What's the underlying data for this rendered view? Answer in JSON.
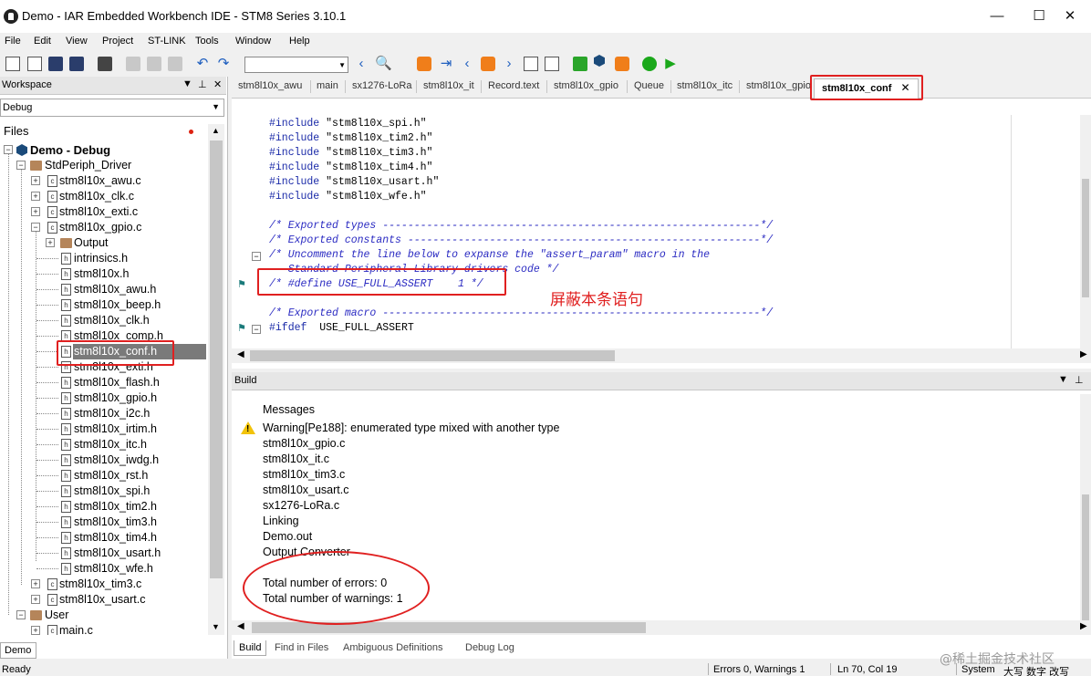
{
  "window": {
    "title": "Demo - IAR Embedded Workbench IDE - STM8 Series 3.10.1",
    "controls": {
      "minimize": "—",
      "maximize": "☐",
      "close": "✕"
    }
  },
  "menu": [
    "File",
    "Edit",
    "View",
    "Project",
    "ST-LINK",
    "Tools",
    "Window",
    "Help"
  ],
  "workspace": {
    "title": "Workspace",
    "configuration": "Debug",
    "files_header": "Files",
    "bottom_tab": "Demo",
    "tree": [
      {
        "label": "Demo - Debug",
        "kind": "project"
      },
      {
        "label": "StdPeriph_Driver",
        "kind": "folder"
      },
      {
        "label": "stm8l10x_awu.c",
        "kind": "c"
      },
      {
        "label": "stm8l10x_clk.c",
        "kind": "c"
      },
      {
        "label": "stm8l10x_exti.c",
        "kind": "c"
      },
      {
        "label": "stm8l10x_gpio.c",
        "kind": "c"
      },
      {
        "label": "Output",
        "kind": "folder"
      },
      {
        "label": "intrinsics.h",
        "kind": "h"
      },
      {
        "label": "stm8l10x.h",
        "kind": "h"
      },
      {
        "label": "stm8l10x_awu.h",
        "kind": "h"
      },
      {
        "label": "stm8l10x_beep.h",
        "kind": "h"
      },
      {
        "label": "stm8l10x_clk.h",
        "kind": "h"
      },
      {
        "label": "stm8l10x_comp.h",
        "kind": "h"
      },
      {
        "label": "stm8l10x_conf.h",
        "kind": "h",
        "selected": true
      },
      {
        "label": "stm8l10x_exti.h",
        "kind": "h"
      },
      {
        "label": "stm8l10x_flash.h",
        "kind": "h"
      },
      {
        "label": "stm8l10x_gpio.h",
        "kind": "h"
      },
      {
        "label": "stm8l10x_i2c.h",
        "kind": "h"
      },
      {
        "label": "stm8l10x_irtim.h",
        "kind": "h"
      },
      {
        "label": "stm8l10x_itc.h",
        "kind": "h"
      },
      {
        "label": "stm8l10x_iwdg.h",
        "kind": "h"
      },
      {
        "label": "stm8l10x_rst.h",
        "kind": "h"
      },
      {
        "label": "stm8l10x_spi.h",
        "kind": "h"
      },
      {
        "label": "stm8l10x_tim2.h",
        "kind": "h"
      },
      {
        "label": "stm8l10x_tim3.h",
        "kind": "h"
      },
      {
        "label": "stm8l10x_tim4.h",
        "kind": "h"
      },
      {
        "label": "stm8l10x_usart.h",
        "kind": "h"
      },
      {
        "label": "stm8l10x_wfe.h",
        "kind": "h"
      },
      {
        "label": "stm8l10x_tim3.c",
        "kind": "c"
      },
      {
        "label": "stm8l10x_usart.c",
        "kind": "c"
      },
      {
        "label": "User",
        "kind": "folder"
      },
      {
        "label": "main.c",
        "kind": "c"
      }
    ]
  },
  "editor": {
    "tabs": [
      "stm8l10x_awu",
      "main",
      "sx1276-LoRa",
      "stm8l10x_it",
      "Record.text",
      "stm8l10x_gpio",
      "Queue",
      "stm8l10x_itc",
      "stm8l10x_gpio",
      "stm8l10x_conf"
    ],
    "active_tab_close": "✕",
    "lines": [
      {
        "kind": "include",
        "kw": "#include",
        "rest": " \"stm8l10x_spi.h\""
      },
      {
        "kind": "include",
        "kw": "#include",
        "rest": " \"stm8l10x_tim2.h\""
      },
      {
        "kind": "include",
        "kw": "#include",
        "rest": " \"stm8l10x_tim3.h\""
      },
      {
        "kind": "include",
        "kw": "#include",
        "rest": " \"stm8l10x_tim4.h\""
      },
      {
        "kind": "include",
        "kw": "#include",
        "rest": " \"stm8l10x_usart.h\""
      },
      {
        "kind": "include",
        "kw": "#include",
        "rest": " \"stm8l10x_wfe.h\""
      },
      {
        "kind": "blank",
        "text": ""
      },
      {
        "kind": "comment",
        "text": "/* Exported types ------------------------------------------------------------*/"
      },
      {
        "kind": "comment",
        "text": "/* Exported constants --------------------------------------------------------*/"
      },
      {
        "kind": "comment",
        "text": "/* Uncomment the line below to expanse the \"assert_param\" macro in the"
      },
      {
        "kind": "comment",
        "text": "   Standard Peripheral Library drivers code */"
      },
      {
        "kind": "comment",
        "text": "/* #define USE_FULL_ASSERT    1 */"
      },
      {
        "kind": "blank",
        "text": ""
      },
      {
        "kind": "comment",
        "text": "/* Exported macro ------------------------------------------------------------*/"
      },
      {
        "kind": "ifdef",
        "kw": "#ifdef",
        "rest": "  USE_FULL_ASSERT"
      }
    ],
    "annotation": "屏蔽本条语句"
  },
  "build": {
    "title": "Build",
    "header": "Messages",
    "warning": "Warning[Pe188]: enumerated type mixed with another type",
    "messages": [
      "stm8l10x_gpio.c",
      "stm8l10x_it.c",
      "stm8l10x_tim3.c",
      "stm8l10x_usart.c",
      "sx1276-LoRa.c",
      "Linking",
      "Demo.out",
      "Output Converter"
    ],
    "summary": [
      "Total number of errors: 0",
      "Total number of warnings: 1"
    ],
    "tabs": [
      "Build",
      "Find in Files",
      "Ambiguous Definitions",
      "Debug Log"
    ]
  },
  "status": {
    "left": "Ready",
    "errors": "Errors 0, Warnings 1",
    "position": "Ln 70, Col 19",
    "encoding": "System",
    "ime": "大写  数字  改写"
  },
  "watermark": "@稀土掘金技术社区"
}
